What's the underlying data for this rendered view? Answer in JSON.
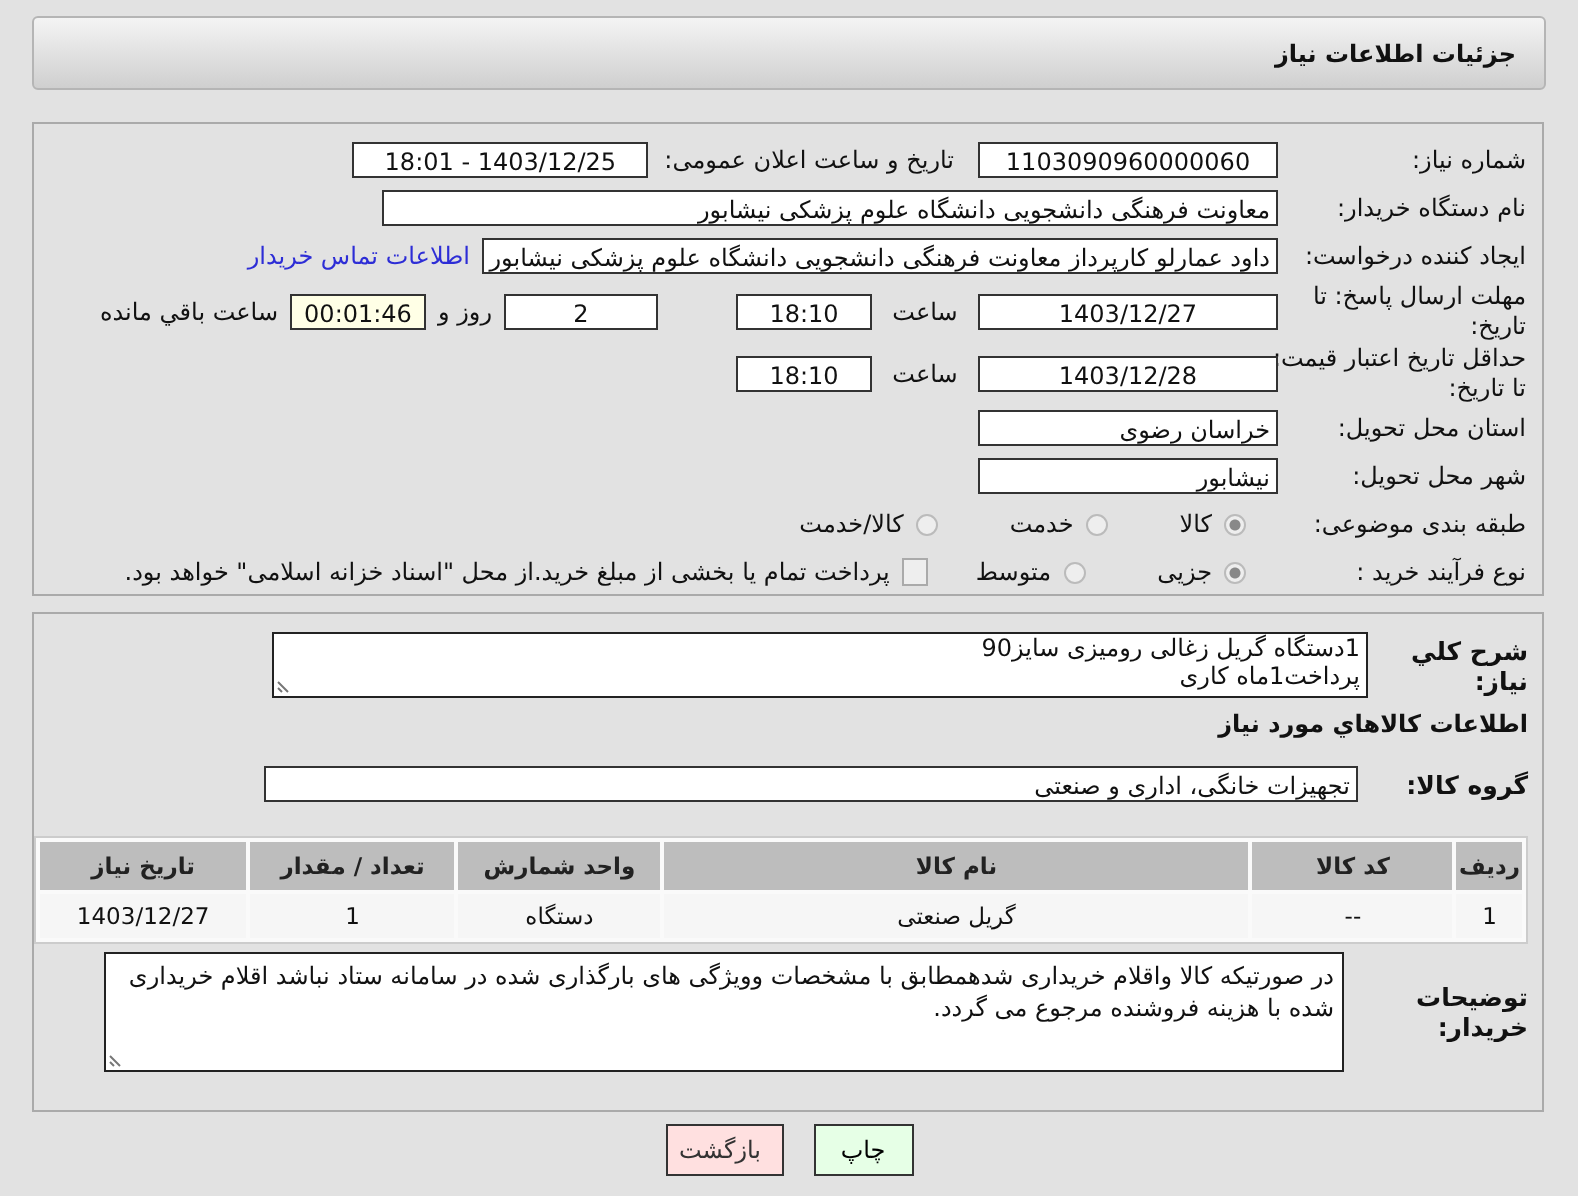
{
  "header": {
    "title": "جزئیات اطلاعات نیاز"
  },
  "need_number": {
    "label": "شماره نیاز:",
    "value": "1103090960000060"
  },
  "announce": {
    "label": "تاریخ و ساعت اعلان عمومی:",
    "value": "1403/12/25 - 18:01"
  },
  "buyer_org": {
    "label": "نام دستگاه خریدار:",
    "value": "معاونت فرهنگی دانشجویی دانشگاه علوم پزشکی نیشابور"
  },
  "requester": {
    "label": "ایجاد کننده درخواست:",
    "value": "داود عمارلو کارپرداز معاونت فرهنگی دانشجویی دانشگاه علوم پزشکی نیشابور",
    "link": "اطلاعات تماس خریدار"
  },
  "reply_deadline": {
    "label": "مهلت ارسال پاسخ: تا تاریخ:",
    "date": "1403/12/27",
    "time_label": "ساعت",
    "time": "18:10",
    "days": "2",
    "days_label": "روز و",
    "remaining": "00:01:46",
    "remaining_label": "ساعت باقي مانده"
  },
  "price_validity": {
    "label": "حداقل تاریخ اعتبار قیمت: تا تاریخ:",
    "date": "1403/12/28",
    "time_label": "ساعت",
    "time": "18:10"
  },
  "province": {
    "label": "استان محل تحویل:",
    "value": "خراسان رضوی"
  },
  "city": {
    "label": "شهر محل تحویل:",
    "value": "نیشابور"
  },
  "category": {
    "label": "طبقه بندی موضوعی:",
    "options": [
      {
        "label": "کالا",
        "selected": true
      },
      {
        "label": "خدمت",
        "selected": false
      },
      {
        "label": "کالا/خدمت",
        "selected": false
      }
    ]
  },
  "purchase_type": {
    "label": "نوع فرآیند خرید :",
    "options": [
      {
        "label": "جزیی",
        "selected": true
      },
      {
        "label": "متوسط",
        "selected": false
      }
    ],
    "payment": {
      "label": "پرداخت تمام یا بخشی از مبلغ خرید.از محل \"اسناد خزانه اسلامی\" خواهد بود.",
      "checked": false
    }
  },
  "description": {
    "label": "شرح کلي نياز:",
    "lines": [
      "1دستگاه گریل زغالی رومیزی سایز90",
      "پرداخت1ماه کاری"
    ]
  },
  "goods_heading": "اطلاعات کالاهاي مورد نياز",
  "goods_group": {
    "label": "گروه کالا:",
    "value": "تجهیزات خانگی، اداری و صنعتی"
  },
  "table": {
    "columns": [
      "ردیف",
      "کد کالا",
      "نام کالا",
      "واحد شمارش",
      "تعداد / مقدار",
      "تاریخ نیاز"
    ],
    "rows": [
      [
        "1",
        "--",
        "گریل صنعتی",
        "دستگاه",
        "1",
        "1403/12/27"
      ]
    ]
  },
  "buyer_notes": {
    "label": "توضیحات خریدار:",
    "text": "در صورتیکه کالا واقلام خریداری شدهمطابق با مشخصات وویژگی های بارگذاری شده در سامانه ستاد نباشد اقلام خریداری شده با هزینه فروشنده مرجوع می گردد."
  },
  "buttons": [
    {
      "label": "چاپ",
      "kind": "print"
    },
    {
      "label": "بازگشت",
      "kind": "back"
    }
  ]
}
